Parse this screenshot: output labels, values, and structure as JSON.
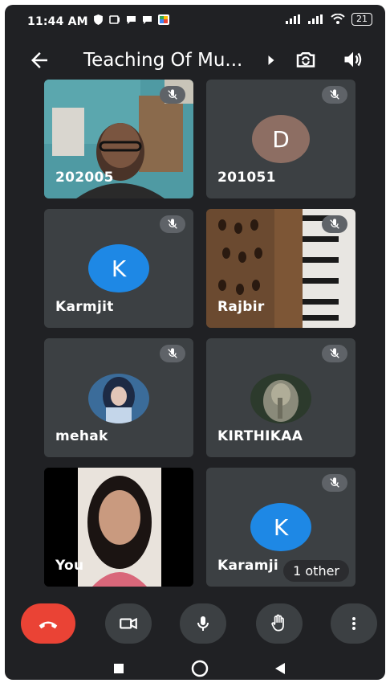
{
  "status": {
    "time": "11:44 AM",
    "battery": "21"
  },
  "header": {
    "title": "Teaching Of Mu..."
  },
  "participants": [
    {
      "name": "202005"
    },
    {
      "name": "201051",
      "initial": "D",
      "color": "#8d6e63"
    },
    {
      "name": "Karmjit",
      "initial": "K",
      "color": "#1e88e5"
    },
    {
      "name": "Rajbir"
    },
    {
      "name": "mehak"
    },
    {
      "name": "KIRTHIKAA"
    },
    {
      "name": "You"
    },
    {
      "name": "Karamji",
      "initial": "K",
      "color": "#1e88e5"
    }
  ],
  "others_badge": "1 other",
  "colors": {
    "background": "#202124",
    "tile": "#3c4043",
    "end_call": "#ea4335",
    "control": "#3c4043"
  }
}
